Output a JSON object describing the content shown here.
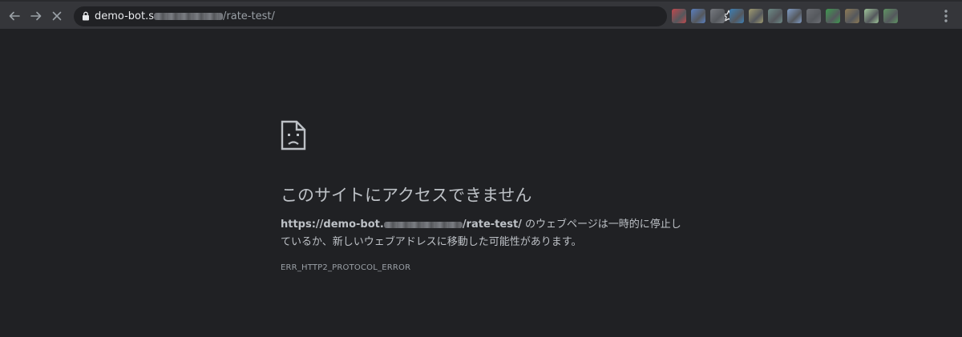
{
  "browser": {
    "url_host": "demo-bot.s",
    "url_path": "/rate-test/",
    "nav_icons": [
      "back-arrow-icon",
      "forward-arrow-icon",
      "stop-loading-icon"
    ],
    "extension_colors": [
      "#c0484d",
      "#5a7fbf",
      "#777a80",
      "#3d7fb5",
      "#a09b70",
      "#6c8a86",
      "#7f9cc6",
      "#6b6e73",
      "#3e9a4f",
      "#8e7b55",
      "#9fc79a",
      "#5f9563"
    ]
  },
  "error_page": {
    "title": "このサイトにアクセスできません",
    "desc_url_start": "https://demo-bot.",
    "desc_url_end": "/rate-test/",
    "desc_rest": " のウェブページは一時的に停止しているか、新しいウェブアドレスに移動した可能性があります。",
    "error_code": "ERR_HTTP2_PROTOCOL_ERROR"
  }
}
